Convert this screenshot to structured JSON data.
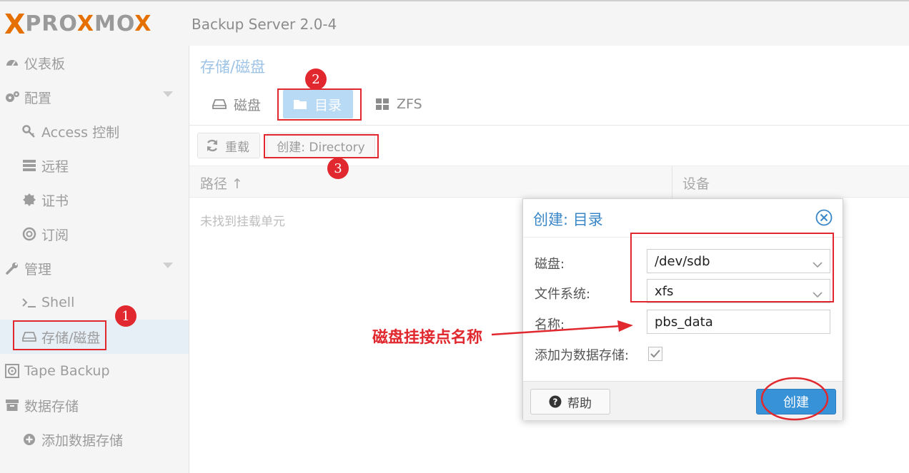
{
  "header": {
    "logo_x": "X",
    "logo_word_1": "PRO",
    "logo_word_o": "X",
    "logo_word_2": "MO",
    "logo_word_o2": "X",
    "product": "Backup Server 2.0-4"
  },
  "sidebar": {
    "items": [
      {
        "label": "仪表板",
        "icon": "dashboard-icon"
      },
      {
        "label": "配置",
        "icon": "gears-icon"
      },
      {
        "label": "Access 控制",
        "icon": "key-icon"
      },
      {
        "label": "远程",
        "icon": "server-icon"
      },
      {
        "label": "证书",
        "icon": "certificate-icon"
      },
      {
        "label": "订阅",
        "icon": "support-icon"
      },
      {
        "label": "管理",
        "icon": "wrench-icon"
      },
      {
        "label": "Shell",
        "icon": "terminal-icon"
      },
      {
        "label": "存储/磁盘",
        "icon": "hdd-icon"
      },
      {
        "label": "Tape Backup",
        "icon": "tape-icon"
      },
      {
        "label": "数据存储",
        "icon": "archive-icon"
      },
      {
        "label": "添加数据存储",
        "icon": "plus-circle-icon"
      }
    ]
  },
  "main": {
    "title": "存储/磁盘",
    "tabs": [
      {
        "label": "磁盘"
      },
      {
        "label": "目录"
      },
      {
        "label": "ZFS"
      }
    ],
    "toolbar": {
      "reload_label": "重载",
      "create_label": "创建: Directory"
    },
    "grid": {
      "col_path": "路径 ↑",
      "col_device": "设备",
      "empty_text": "未找到挂载单元"
    }
  },
  "dialog": {
    "title": "创建: 目录",
    "disk_label": "磁盘:",
    "disk_value": "/dev/sdb",
    "fs_label": "文件系统:",
    "fs_value": "xfs",
    "name_label": "名称:",
    "name_value": "pbs_data",
    "add_ds_label": "添加为数据存储:",
    "add_ds_checked": true,
    "help_label": "帮助",
    "create_label": "创建"
  },
  "annotations": {
    "badge_1": "1",
    "badge_2": "2",
    "badge_3": "3",
    "arrow_text": "磁盘挂接点名称",
    "color": "#e0282e"
  },
  "colors": {
    "accent": "#3892d8",
    "brand_orange": "#e57000",
    "active_tab": "#b9daf5"
  }
}
